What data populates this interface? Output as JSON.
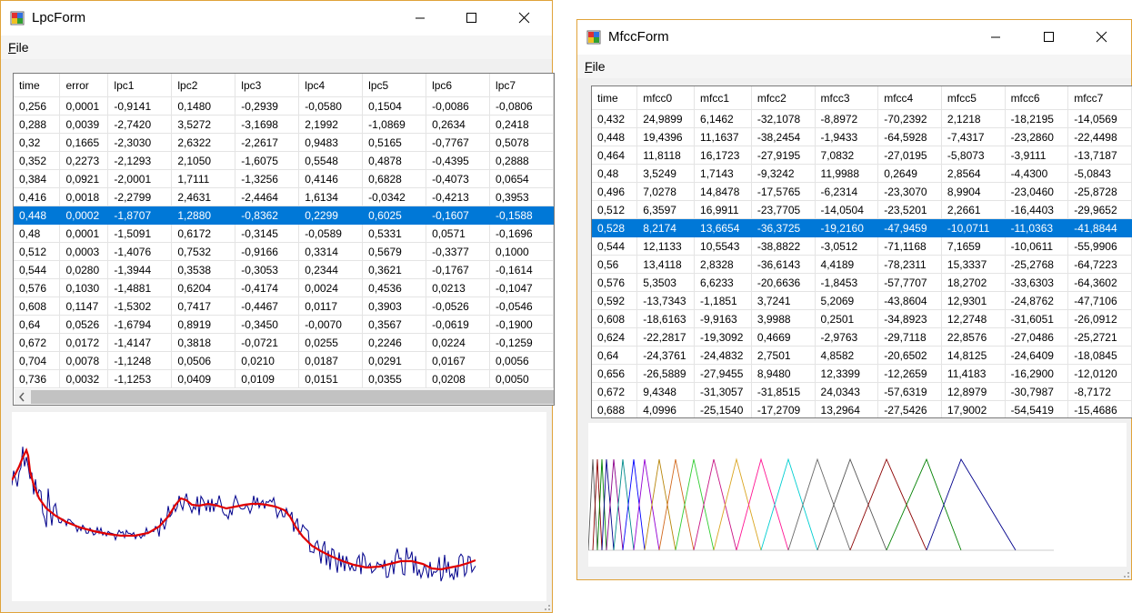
{
  "lpc_form": {
    "title": "LpcForm",
    "menu": {
      "file": "File"
    },
    "columns": [
      "time",
      "error",
      "lpc1",
      "lpc2",
      "lpc3",
      "lpc4",
      "lpc5",
      "lpc6",
      "lpc7"
    ],
    "selected_row": 6,
    "rows": [
      [
        "0,256",
        "0,0001",
        "-0,9141",
        "0,1480",
        "-0,2939",
        "-0,0580",
        "0,1504",
        "-0,0086",
        "-0,0806"
      ],
      [
        "0,288",
        "0,0039",
        "-2,7420",
        "3,5272",
        "-3,1698",
        "2,1992",
        "-1,0869",
        "0,2634",
        "0,2418"
      ],
      [
        "0,32",
        "0,1665",
        "-2,3030",
        "2,6322",
        "-2,2617",
        "0,9483",
        "0,5165",
        "-0,7767",
        "0,5078"
      ],
      [
        "0,352",
        "0,2273",
        "-2,1293",
        "2,1050",
        "-1,6075",
        "0,5548",
        "0,4878",
        "-0,4395",
        "0,2888"
      ],
      [
        "0,384",
        "0,0921",
        "-2,0001",
        "1,7111",
        "-1,3256",
        "0,4146",
        "0,6828",
        "-0,4073",
        "0,0654"
      ],
      [
        "0,416",
        "0,0018",
        "-2,2799",
        "2,4631",
        "-2,4464",
        "1,6134",
        "-0,0342",
        "-0,4213",
        "0,3953"
      ],
      [
        "0,448",
        "0,0002",
        "-1,8707",
        "1,2880",
        "-0,8362",
        "0,2299",
        "0,6025",
        "-0,1607",
        "-0,1588"
      ],
      [
        "0,48",
        "0,0001",
        "-1,5091",
        "0,6172",
        "-0,3145",
        "-0,0589",
        "0,5331",
        "0,0571",
        "-0,1696"
      ],
      [
        "0,512",
        "0,0003",
        "-1,4076",
        "0,7532",
        "-0,9166",
        "0,3314",
        "0,5679",
        "-0,3377",
        "0,1000"
      ],
      [
        "0,544",
        "0,0280",
        "-1,3944",
        "0,3538",
        "-0,3053",
        "0,2344",
        "0,3621",
        "-0,1767",
        "-0,1614"
      ],
      [
        "0,576",
        "0,1030",
        "-1,4881",
        "0,6204",
        "-0,4174",
        "0,0024",
        "0,4536",
        "0,0213",
        "-0,1047"
      ],
      [
        "0,608",
        "0,1147",
        "-1,5302",
        "0,7417",
        "-0,4467",
        "0,0117",
        "0,3903",
        "-0,0526",
        "-0,0546"
      ],
      [
        "0,64",
        "0,0526",
        "-1,6794",
        "0,8919",
        "-0,3450",
        "-0,0070",
        "0,3567",
        "-0,0619",
        "-0,1900"
      ],
      [
        "0,672",
        "0,0172",
        "-1,4147",
        "0,3818",
        "-0,0721",
        "0,0255",
        "0,2246",
        "0,0224",
        "-0,1259"
      ],
      [
        "0,704",
        "0,0078",
        "-1,1248",
        "0,0506",
        "0,0210",
        "0,0187",
        "0,0291",
        "0,0167",
        "0,0056"
      ],
      [
        "0,736",
        "0,0032",
        "-1,1253",
        "0,0409",
        "0,0109",
        "0,0151",
        "0,0355",
        "0,0208",
        "0,0050"
      ]
    ]
  },
  "mfcc_form": {
    "title": "MfccForm",
    "menu": {
      "file": "File"
    },
    "columns": [
      "time",
      "mfcc0",
      "mfcc1",
      "mfcc2",
      "mfcc3",
      "mfcc4",
      "mfcc5",
      "mfcc6",
      "mfcc7"
    ],
    "selected_row": 6,
    "rows": [
      [
        "0,432",
        "24,9899",
        "6,1462",
        "-32,1078",
        "-8,8972",
        "-70,2392",
        "2,1218",
        "-18,2195",
        "-14,0569"
      ],
      [
        "0,448",
        "19,4396",
        "11,1637",
        "-38,2454",
        "-1,9433",
        "-64,5928",
        "-7,4317",
        "-23,2860",
        "-22,4498"
      ],
      [
        "0,464",
        "11,8118",
        "16,1723",
        "-27,9195",
        "7,0832",
        "-27,0195",
        "-5,8073",
        "-3,9111",
        "-13,7187"
      ],
      [
        "0,48",
        "3,5249",
        "1,7143",
        "-9,3242",
        "11,9988",
        "0,2649",
        "2,8564",
        "-4,4300",
        "-5,0843"
      ],
      [
        "0,496",
        "7,0278",
        "14,8478",
        "-17,5765",
        "-6,2314",
        "-23,3070",
        "8,9904",
        "-23,0460",
        "-25,8728"
      ],
      [
        "0,512",
        "6,3597",
        "16,9911",
        "-23,7705",
        "-14,0504",
        "-23,5201",
        "2,2661",
        "-16,4403",
        "-29,9652"
      ],
      [
        "0,528",
        "8,2174",
        "13,6654",
        "-36,3725",
        "-19,2160",
        "-47,9459",
        "-10,0711",
        "-11,0363",
        "-41,8844"
      ],
      [
        "0,544",
        "12,1133",
        "10,5543",
        "-38,8822",
        "-3,0512",
        "-71,1168",
        "7,1659",
        "-10,0611",
        "-55,9906"
      ],
      [
        "0,56",
        "13,4118",
        "2,8328",
        "-36,6143",
        "4,4189",
        "-78,2311",
        "15,3337",
        "-25,2768",
        "-64,7223"
      ],
      [
        "0,576",
        "5,3503",
        "6,6233",
        "-20,6636",
        "-1,8453",
        "-57,7707",
        "18,2702",
        "-33,6303",
        "-64,3602"
      ],
      [
        "0,592",
        "-13,7343",
        "-1,1851",
        "3,7241",
        "5,2069",
        "-43,8604",
        "12,9301",
        "-24,8762",
        "-47,7106"
      ],
      [
        "0,608",
        "-18,6163",
        "-9,9163",
        "3,9988",
        "0,2501",
        "-34,8923",
        "12,2748",
        "-31,6051",
        "-26,0912"
      ],
      [
        "0,624",
        "-22,2817",
        "-19,3092",
        "0,4669",
        "-2,9763",
        "-29,7118",
        "22,8576",
        "-27,0486",
        "-25,2721"
      ],
      [
        "0,64",
        "-24,3761",
        "-24,4832",
        "2,7501",
        "4,8582",
        "-20,6502",
        "14,8125",
        "-24,6409",
        "-18,0845"
      ],
      [
        "0,656",
        "-26,5889",
        "-27,9455",
        "8,9480",
        "12,3399",
        "-12,2659",
        "11,4183",
        "-16,2900",
        "-12,0120"
      ],
      [
        "0,672",
        "9,4348",
        "-31,3057",
        "-31,8515",
        "24,0343",
        "-57,6319",
        "12,8979",
        "-30,7987",
        "-8,7172"
      ],
      [
        "0,688",
        "4,0996",
        "-25,1540",
        "-17,2709",
        "13,2964",
        "-27,5426",
        "17,9002",
        "-54,5419",
        "-15,4686"
      ]
    ]
  },
  "colors": {
    "selection": "#0078d7",
    "spectrum": "#00008b",
    "envelope": "#e00000",
    "filter_colors": [
      "#555555",
      "#8b0000",
      "#008000",
      "#00008b",
      "#8b008b",
      "#008b8b",
      "#0000ff",
      "#9400d3",
      "#b8860b",
      "#d2691e",
      "#32cd32",
      "#c71585",
      "#daa520",
      "#ff1493",
      "#00ced1",
      "#696969"
    ]
  }
}
